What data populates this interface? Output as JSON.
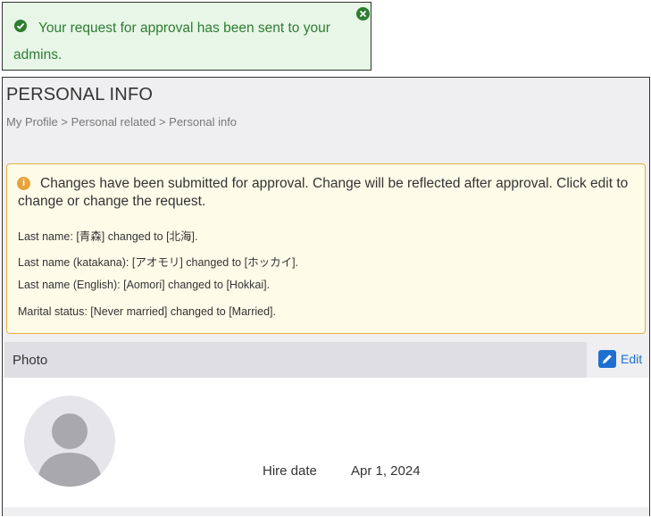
{
  "toast": {
    "message": "Your request for approval has been sent to your admins."
  },
  "page": {
    "title": "PERSONAL INFO",
    "breadcrumb": [
      "My Profile",
      "Personal related",
      "Personal info"
    ],
    "breadcrumb_separator": ">"
  },
  "notice": {
    "message": "Changes have been submitted for approval. Change will be reflected after approval. Click edit to change or change the request.",
    "changes": [
      "Last name: [青森] changed to [北海].",
      "Last name (katakana): [アオモリ] changed to [ホッカイ].",
      "Last name (English): [Aomori] changed to [Hokkai].",
      "Marital status: [Never married] changed to [Married]."
    ]
  },
  "photo_section": {
    "label": "Photo",
    "edit_label": "Edit"
  },
  "profile": {
    "hire_date_label": "Hire date",
    "hire_date_value": "Apr 1, 2024"
  },
  "colors": {
    "success": "#2e7d32",
    "warning": "#e8a33a",
    "link": "#1f6fd0"
  },
  "icons": {
    "toast_icon": "check-circle-icon",
    "toast_close": "close-icon",
    "notice_icon": "info-icon",
    "edit_icon": "pencil-icon",
    "avatar": "person-silhouette"
  }
}
